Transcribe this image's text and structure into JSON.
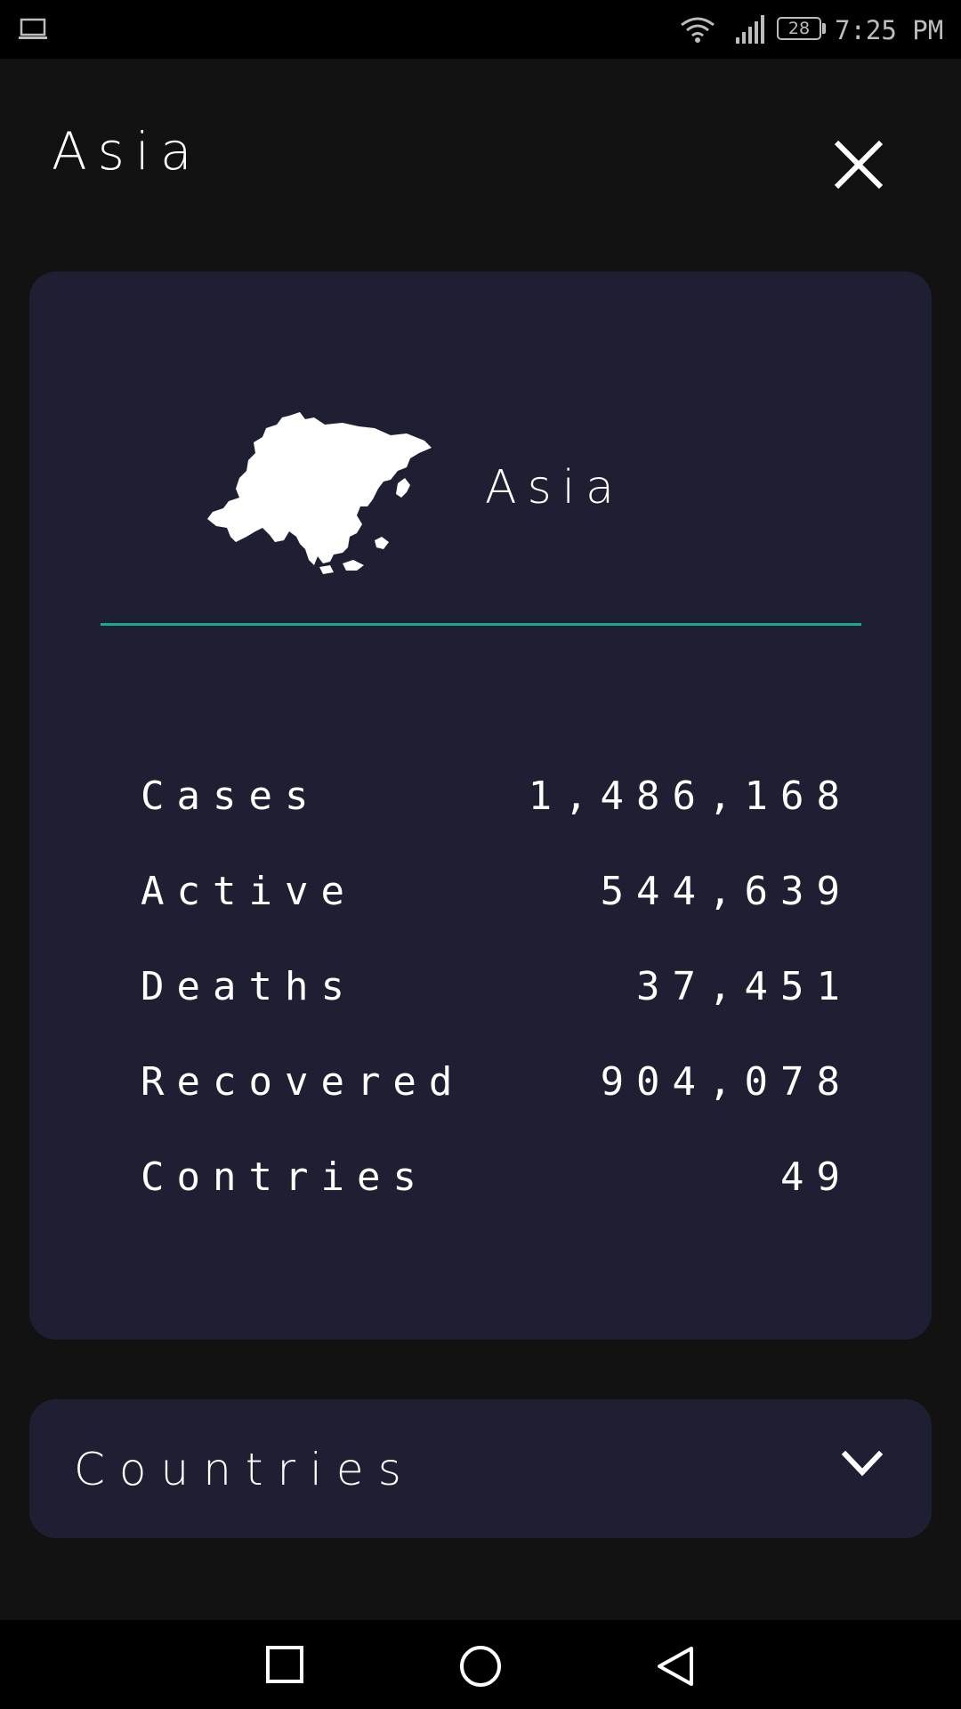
{
  "status_bar": {
    "time": "7:25 PM",
    "battery": "28",
    "icons": [
      "laptop-icon",
      "wifi-icon",
      "signal-icon",
      "battery-icon"
    ]
  },
  "header": {
    "title": "Asia",
    "close_icon": "close-icon"
  },
  "card": {
    "title": "Asia",
    "map_icon": "asia-map",
    "accent_color": "#1aa98a",
    "stats": [
      {
        "label": "Cases",
        "value": "1,486,168"
      },
      {
        "label": "Active",
        "value": "544,639"
      },
      {
        "label": "Deaths",
        "value": "37,451"
      },
      {
        "label": "Recovered",
        "value": "904,078"
      },
      {
        "label": "Contries",
        "value": "49"
      }
    ]
  },
  "countries": {
    "label": "Countries",
    "icon": "chevron-down-icon"
  },
  "nav_bar": {
    "icons": [
      "recent-apps-icon",
      "home-icon",
      "back-icon"
    ]
  },
  "colors": {
    "background": "#121212",
    "card": "#1f1f33",
    "text": "#ffffff"
  }
}
